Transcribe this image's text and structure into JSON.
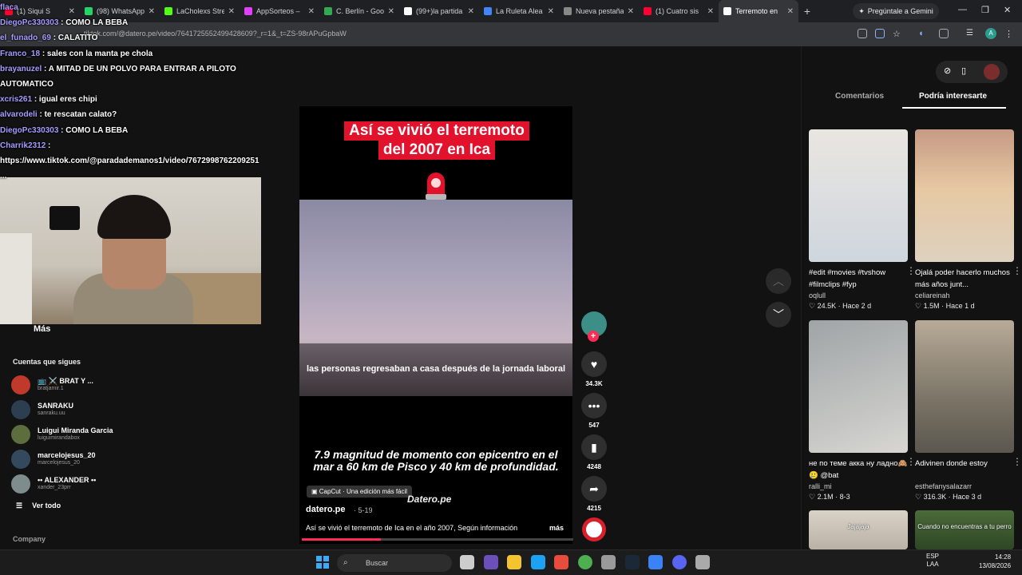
{
  "browser": {
    "tabs": [
      {
        "label": "(1) Siqui S",
        "color": "#ff0033"
      },
      {
        "label": "(98) WhatsApp",
        "color": "#25d366"
      },
      {
        "label": "LaCholexs Stre",
        "color": "#53fc18"
      },
      {
        "label": "AppSorteos –",
        "color": "#e040fb"
      },
      {
        "label": "C. Berlín - Goo",
        "color": "#34a853"
      },
      {
        "label": "(99+)la partida",
        "color": "#ffffff"
      },
      {
        "label": "La Ruleta Alea",
        "color": "#4285f4"
      },
      {
        "label": "Nueva pestaña",
        "color": "#888888"
      },
      {
        "label": "(1) Cuatro sis",
        "color": "#ff0033"
      },
      {
        "label": "Terremoto en",
        "color": "#ffffff"
      }
    ],
    "new_tab": "+",
    "gemini_label": "Pregúntale a Gemini",
    "url": "tiktok.com/@datero.pe/video/7641725552499428609?_r=1&_t=ZS-98rAPuGpbaW",
    "profile_initial": "A"
  },
  "chat": [
    {
      "user": "flaca",
      "msg": ""
    },
    {
      "user": "DiegoPc330303",
      "msg": ": COMO LA BEBA"
    },
    {
      "user": "el_funado_69",
      "msg": ": CALATITO"
    },
    {
      "user": "Franco_18",
      "msg": ": sales con la manta pe chola"
    },
    {
      "user": "brayanuzel",
      "msg": ": A MITAD DE UN POLVO PARA ENTRAR A PILOTO AUTOMATICO"
    },
    {
      "user": "xcris261",
      "msg": ": igual eres chipi"
    },
    {
      "user": "alvarodeli",
      "msg": ": te rescatan calato?"
    },
    {
      "user": "DiegoPc330303",
      "msg": ": COMO LA BEBA"
    },
    {
      "user": "Charrik2312",
      "msg": ":"
    },
    {
      "user": "",
      "msg": "https://www.tiktok.com/@paradademanos1/video/7672998762209251 ..."
    }
  ],
  "leftnav": {
    "more": "Más",
    "following_title": "Cuentas que sigues",
    "accounts": [
      {
        "name": "📺 ⚔️ BRAT Y ...",
        "handle": "bratjamir.1",
        "color": "#c0392b"
      },
      {
        "name": "SANRAKU",
        "handle": "sanraku.uu",
        "color": "#2c3e50"
      },
      {
        "name": "Luigui Miranda Garcia",
        "handle": "luiguimirandabox",
        "color": "#5d6d3e"
      },
      {
        "name": "marcelojesus_20",
        "handle": "marcelojesus_20",
        "color": "#34495e"
      },
      {
        "name": "•• ALEXANDER ••",
        "handle": "xander_23prr",
        "color": "#7f8c8d"
      }
    ],
    "see_all": "Ver todo",
    "company": "Company"
  },
  "video": {
    "title_line1": "Así se vivió el terremoto",
    "title_line2": "del 2007 en Ica",
    "subtitle": "las personas regresaban a casa después de la jornada laboral",
    "magnitude_text": "7.9 magnitud de momento con epicentro en el mar a 60 km de Pisco y 40 km de profundidad.",
    "capcut": "CapCut · Una edición más fácil",
    "watermark": "Datero.pe",
    "author": "datero.pe",
    "date": "· 5-19",
    "description": "Así se vivió el terremoto de Ica en el año 2007, Según información",
    "more": "más",
    "progress": 0.29
  },
  "actions": {
    "likes": "34.3K",
    "comments": "547",
    "saves": "4248",
    "shares": "4215"
  },
  "rightpanel": {
    "tabs": [
      "Comentarios",
      "Podría interesarte"
    ],
    "cards": [
      {
        "title": "#edit #movies #tvshow #filmclips #fyp",
        "user": "oqlull",
        "likes": "24.5K",
        "time": "Hace 2 d"
      },
      {
        "title": "Ojalá poder hacerlo muchos más años junt...",
        "user": "celiareinah",
        "likes": "1.5M",
        "time": "Hace 1 d"
      },
      {
        "title": "не по теме акка ну ладно🙈🥲 @bat",
        "user": "ralli_mi",
        "likes": "2.1M",
        "time": "8-3"
      },
      {
        "title": "Adivinen donde estoy",
        "user": "esthefanysalazarr",
        "likes": "316.3K",
        "time": "Hace 3 d"
      },
      {
        "title": "Jajajaja",
        "user": "",
        "likes": "",
        "time": ""
      },
      {
        "title": "Cuando no encuentras a tu perro",
        "user": "",
        "likes": "",
        "time": ""
      }
    ]
  },
  "taskbar": {
    "search": "Buscar",
    "lang1": "ESP",
    "lang2": "LAA",
    "time": "14:28",
    "date": "13/08/2026"
  }
}
